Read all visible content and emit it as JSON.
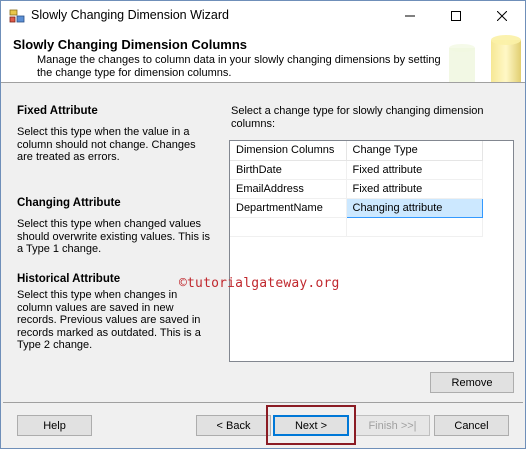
{
  "window": {
    "title": "Slowly Changing Dimension Wizard",
    "controls": {
      "minimize": "—",
      "maximize": "☐",
      "close": "✕"
    }
  },
  "header": {
    "title": "Slowly Changing Dimension Columns",
    "description": "Manage the changes to column data in your slowly changing dimensions by setting the change type for dimension columns."
  },
  "help_sections": [
    {
      "heading": "Fixed Attribute",
      "text": "Select this type when the value in a column should not change. Changes are treated as errors."
    },
    {
      "heading": "Changing Attribute",
      "text": "Select this type when changed values should overwrite existing values. This is a Type 1 change."
    },
    {
      "heading": "Historical Attribute",
      "text": "Select this type when changes in column values are saved in new records. Previous values are saved in records marked as outdated. This is a Type 2 change."
    }
  ],
  "grid": {
    "caption": "Select a change type for slowly changing dimension columns:",
    "headers": [
      "Dimension Columns",
      "Change Type"
    ],
    "rows": [
      {
        "column": "BirthDate",
        "change_type": "Fixed attribute"
      },
      {
        "column": "EmailAddress",
        "change_type": "Fixed attribute"
      },
      {
        "column": "DepartmentName",
        "change_type": "Changing attribute"
      }
    ]
  },
  "watermark": "©tutorialgateway.org",
  "buttons": {
    "remove": "Remove",
    "help": "Help",
    "back": "< Back",
    "next": "Next >",
    "finish": "Finish >>|",
    "cancel": "Cancel"
  },
  "colors": {
    "accent": "#0078d7",
    "selection": "#cce8ff",
    "highlight_frame": "#8b1c24",
    "watermark": "#c0282e"
  }
}
